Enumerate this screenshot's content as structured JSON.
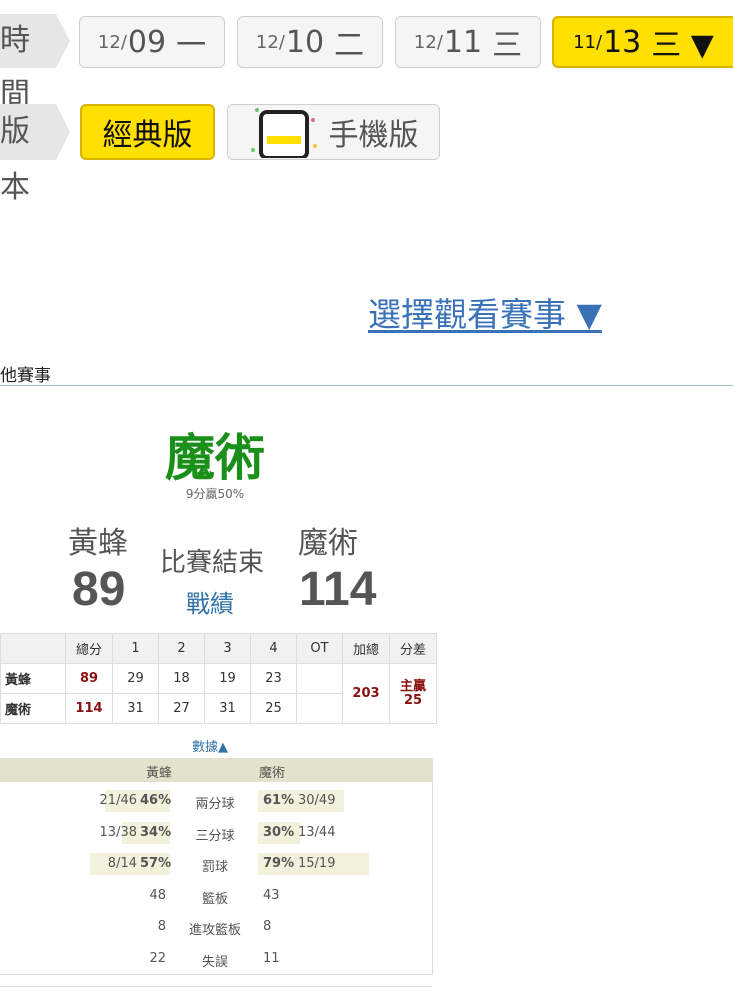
{
  "date_row": {
    "label": "時間",
    "dates": [
      {
        "md": "12/",
        "dd": "09",
        "wk": "一",
        "active": false
      },
      {
        "md": "12/",
        "dd": "10",
        "wk": "二",
        "active": false
      },
      {
        "md": "12/",
        "dd": "11",
        "wk": "三",
        "active": false
      },
      {
        "md": "11/",
        "dd": "13",
        "wk": "三 ▼",
        "active": true
      }
    ]
  },
  "version_row": {
    "label": "版本",
    "classic": "經典版",
    "mobile": "手機版"
  },
  "select_game": "選擇觀看賽事 ▼",
  "section_title": "他賽事",
  "result": {
    "winner": "魔術",
    "winner_sub": "9分贏50%",
    "away_name": "黃蜂",
    "home_name": "魔術",
    "away_score": "89",
    "home_score": "114",
    "status": "比賽結束",
    "record_link": "戰績"
  },
  "quarter_table": {
    "headers": [
      "總分",
      "1",
      "2",
      "3",
      "4",
      "OT",
      "加總",
      "分差"
    ],
    "rows": [
      {
        "team": "黃蜂",
        "total": "89",
        "q": [
          "29",
          "18",
          "19",
          "23"
        ],
        "ot": ""
      },
      {
        "team": "魔術",
        "total": "114",
        "q": [
          "31",
          "27",
          "31",
          "25"
        ],
        "ot": ""
      }
    ],
    "sum": "203",
    "diff_label": "主贏",
    "diff_value": "25"
  },
  "data_toggle": "數據▲",
  "stats": {
    "away": "黃蜂",
    "home": "魔術",
    "rows": [
      {
        "label": "兩分球",
        "away": "21/46",
        "away_pct": "46%",
        "home_pct": "61%",
        "home": "30/49",
        "away_frac": 0.46,
        "home_frac": 0.61
      },
      {
        "label": "三分球",
        "away": "13/38",
        "away_pct": "34%",
        "home_pct": "30%",
        "home": "13/44",
        "away_frac": 0.34,
        "home_frac": 0.3
      },
      {
        "label": "罰球",
        "away": "8/14",
        "away_pct": "57%",
        "home_pct": "79%",
        "home": "15/19",
        "away_frac": 0.57,
        "home_frac": 0.79
      },
      {
        "label": "籃板",
        "away": "48",
        "home": "43"
      },
      {
        "label": "進攻籃板",
        "away": "8",
        "home": "8"
      },
      {
        "label": "失誤",
        "away": "22",
        "home": "11"
      }
    ]
  }
}
